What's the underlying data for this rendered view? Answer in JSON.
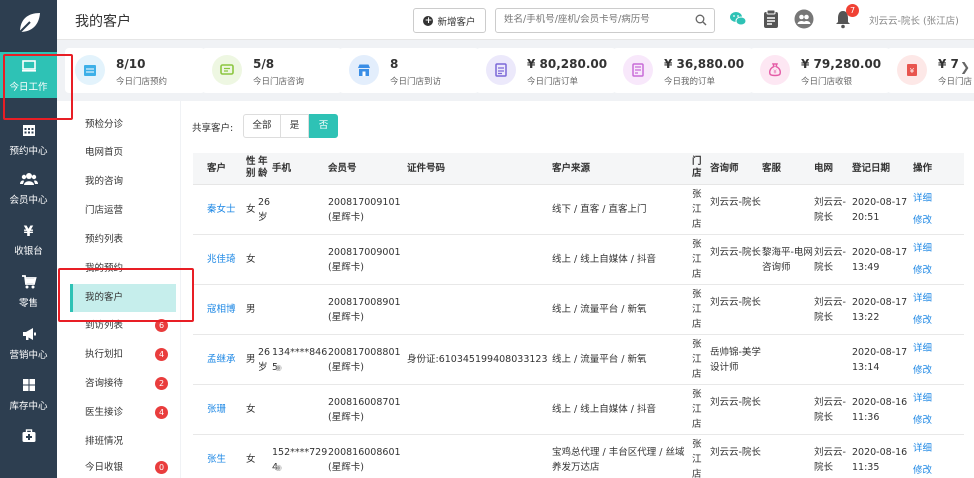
{
  "header": {
    "title": "我的客户",
    "new_customer_label": "新增客户",
    "search_placeholder": "姓名/手机号/座机/会员卡号/病历号",
    "notification_count": "7",
    "user": "刘云云-院长 (张江店)"
  },
  "nav": [
    {
      "label": "今日工作",
      "icon": "monitor-icon",
      "active": true
    },
    {
      "label": "预约中心",
      "icon": "calendar-icon"
    },
    {
      "label": "会员中心",
      "icon": "users-icon"
    },
    {
      "label": "收银台",
      "icon": "yen-icon"
    },
    {
      "label": "零售",
      "icon": "cart-icon"
    },
    {
      "label": "营销中心",
      "icon": "megaphone-icon"
    },
    {
      "label": "库存中心",
      "icon": "grid-icon"
    },
    {
      "label": "",
      "icon": "medkit-icon"
    }
  ],
  "stats": [
    {
      "value": "8/10",
      "label": "今日门店预约",
      "icon": "calendar-icon",
      "color": "#3db0e8",
      "bg": "#e3f3fc"
    },
    {
      "value": "5/8",
      "label": "今日门店咨询",
      "icon": "chat-icon",
      "color": "#8cc63f",
      "bg": "#eef7e2"
    },
    {
      "value": "8",
      "label": "今日门店到访",
      "icon": "store-icon",
      "color": "#3a8ee6",
      "bg": "#e3eefc"
    },
    {
      "value": "¥ 80,280.00",
      "label": "今日门店订单",
      "icon": "order-icon",
      "color": "#7b68d8",
      "bg": "#ece9fb"
    },
    {
      "value": "¥ 36,880.00",
      "label": "今日我的订单",
      "icon": "doc-icon",
      "color": "#c86ad8",
      "bg": "#f8e8fb"
    },
    {
      "value": "¥ 79,280.00",
      "label": "今日门店收银",
      "icon": "money-bag-icon",
      "color": "#e45ba6",
      "bg": "#fde7f3"
    },
    {
      "value": "¥ 7",
      "label": "今日门店",
      "icon": "receipt-icon",
      "color": "#e8554e",
      "bg": "#fde8e7"
    }
  ],
  "submenu": [
    {
      "label": "预检分诊"
    },
    {
      "label": "电网首页"
    },
    {
      "label": "我的咨询"
    },
    {
      "label": "门店运营"
    },
    {
      "label": "预约列表"
    },
    {
      "label": "我的预约"
    },
    {
      "label": "我的客户",
      "active": true
    },
    {
      "label": "到访列表",
      "badge": "6"
    },
    {
      "label": "执行划扣",
      "badge": "4"
    },
    {
      "label": "咨询接待",
      "badge": "2"
    },
    {
      "label": "医生接诊",
      "badge": "4"
    },
    {
      "label": "排班情况"
    },
    {
      "label": "今日收银",
      "badge": "0"
    }
  ],
  "filter": {
    "label": "共享客户:",
    "options": [
      "全部",
      "是",
      "否"
    ],
    "selected": "否"
  },
  "table": {
    "headers": {
      "customer": "客户",
      "gender": "性别",
      "age": "年龄",
      "phone": "手机",
      "member": "会员号",
      "idcard": "证件号码",
      "source": "客户来源",
      "store": "门店",
      "consultant": "咨询师",
      "service": "客服",
      "network": "电网",
      "reg_date": "登记日期",
      "ops": "操作"
    },
    "rows": [
      {
        "name": "秦女士",
        "gender": "女",
        "age": "26岁",
        "phone": "",
        "member": "200817009101(星辉卡)",
        "idcard": "",
        "source": "线下 / 直客 / 直客上门",
        "store": "张江店",
        "consultant": "刘云云-院长",
        "service": "",
        "network": "刘云云-院长",
        "date": "2020-08-17 20:51",
        "op1": "详细",
        "op2": "修改"
      },
      {
        "name": "兆佳琦",
        "gender": "女",
        "age": "",
        "phone": "",
        "member": "200817009001(星辉卡)",
        "idcard": "",
        "source": "线上 / 线上自媒体 / 抖音",
        "store": "张江店",
        "consultant": "刘云云-院长",
        "service": "黎海平-电网咨询师",
        "network": "刘云云-院长",
        "date": "2020-08-17 13:49",
        "op1": "详细",
        "op2": "修改"
      },
      {
        "name": "寇相博",
        "gender": "男",
        "age": "",
        "phone": "",
        "member": "200817008901(星辉卡)",
        "idcard": "",
        "source": "线上 / 流量平台 / 新氧",
        "store": "张江店",
        "consultant": "刘云云-院长",
        "service": "",
        "network": "刘云云-院长",
        "date": "2020-08-17 13:22",
        "op1": "详细",
        "op2": "修改"
      },
      {
        "name": "孟继承",
        "gender": "男",
        "age": "26岁",
        "phone": "134****8465",
        "member": "200817008801(星辉卡)",
        "idcard": "身份证:610345199408033123",
        "source": "线上 / 流量平台 / 新氧",
        "store": "张江店",
        "consultant": "岳帅锦-美学设计师",
        "service": "",
        "network": "",
        "date": "2020-08-17 13:14",
        "op1": "详细",
        "op2": "修改"
      },
      {
        "name": "张珊",
        "gender": "女",
        "age": "",
        "phone": "",
        "member": "200816008701(星辉卡)",
        "idcard": "",
        "source": "线上 / 线上自媒体 / 抖音",
        "store": "张江店",
        "consultant": "刘云云-院长",
        "service": "",
        "network": "刘云云-院长",
        "date": "2020-08-16 11:36",
        "op1": "详细",
        "op2": "修改"
      },
      {
        "name": "张生",
        "gender": "女",
        "age": "",
        "phone": "152****7294",
        "member": "200816008601(星辉卡)",
        "idcard": "",
        "source": "宝鸡总代理 / 丰台区代理 / 丝域养发万达店",
        "store": "张江店",
        "consultant": "刘云云-院长",
        "service": "",
        "network": "刘云云-院长",
        "date": "2020-08-16 11:35",
        "op1": "详细",
        "op2": "修改"
      }
    ]
  }
}
